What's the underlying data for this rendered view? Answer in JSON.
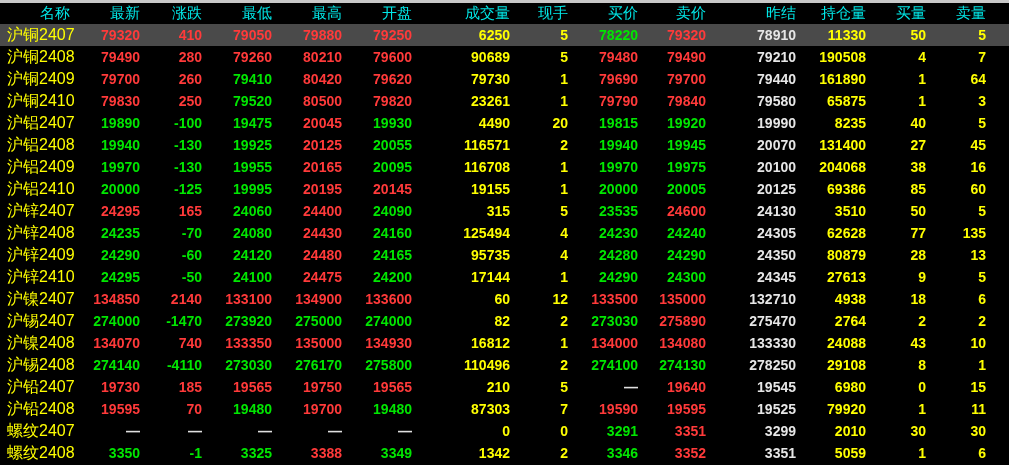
{
  "columns": [
    {
      "label": "名称",
      "kind": "name"
    },
    {
      "label": "最新",
      "kind": "price"
    },
    {
      "label": "涨跌",
      "kind": "price"
    },
    {
      "label": "最低",
      "kind": "price"
    },
    {
      "label": "最高",
      "kind": "price"
    },
    {
      "label": "开盘",
      "kind": "price"
    },
    {
      "label": "成交量",
      "kind": "volume"
    },
    {
      "label": "现手",
      "kind": "volume"
    },
    {
      "label": "买价",
      "kind": "price"
    },
    {
      "label": "卖价",
      "kind": "price"
    },
    {
      "label": "昨结",
      "kind": "reference"
    },
    {
      "label": "持仓量",
      "kind": "volume"
    },
    {
      "label": "买量",
      "kind": "volume"
    },
    {
      "label": "卖量",
      "kind": "volume"
    }
  ],
  "rows": [
    {
      "name": "沪铜2407",
      "selected": true,
      "cells": [
        {
          "text": "79320",
          "color": "#ff3a3a"
        },
        {
          "text": "410",
          "color": "#ff3a3a"
        },
        {
          "text": "79050",
          "color": "#ff3a3a"
        },
        {
          "text": "79880",
          "color": "#ff3a3a"
        },
        {
          "text": "79250",
          "color": "#ff3a3a"
        },
        {
          "text": "6250"
        },
        {
          "text": "5"
        },
        {
          "text": "78220",
          "color": "#00e600"
        },
        {
          "text": "79320",
          "color": "#ff3a3a"
        },
        {
          "text": "78910"
        },
        {
          "text": "11330"
        },
        {
          "text": "50"
        },
        {
          "text": "5"
        }
      ]
    },
    {
      "name": "沪铜2408",
      "selected": false,
      "cells": [
        {
          "text": "79490",
          "color": "#ff3a3a"
        },
        {
          "text": "280",
          "color": "#ff3a3a"
        },
        {
          "text": "79260",
          "color": "#ff3a3a"
        },
        {
          "text": "80210",
          "color": "#ff3a3a"
        },
        {
          "text": "79600",
          "color": "#ff3a3a"
        },
        {
          "text": "90689"
        },
        {
          "text": "5"
        },
        {
          "text": "79480",
          "color": "#ff3a3a"
        },
        {
          "text": "79490",
          "color": "#ff3a3a"
        },
        {
          "text": "79210"
        },
        {
          "text": "190508"
        },
        {
          "text": "4"
        },
        {
          "text": "7"
        }
      ]
    },
    {
      "name": "沪铜2409",
      "selected": false,
      "cells": [
        {
          "text": "79700",
          "color": "#ff3a3a"
        },
        {
          "text": "260",
          "color": "#ff3a3a"
        },
        {
          "text": "79410",
          "color": "#00e600"
        },
        {
          "text": "80420",
          "color": "#ff3a3a"
        },
        {
          "text": "79620",
          "color": "#ff3a3a"
        },
        {
          "text": "79730"
        },
        {
          "text": "1"
        },
        {
          "text": "79690",
          "color": "#ff3a3a"
        },
        {
          "text": "79700",
          "color": "#ff3a3a"
        },
        {
          "text": "79440"
        },
        {
          "text": "161890"
        },
        {
          "text": "1"
        },
        {
          "text": "64"
        }
      ]
    },
    {
      "name": "沪铜2410",
      "selected": false,
      "cells": [
        {
          "text": "79830",
          "color": "#ff3a3a"
        },
        {
          "text": "250",
          "color": "#ff3a3a"
        },
        {
          "text": "79520",
          "color": "#00e600"
        },
        {
          "text": "80500",
          "color": "#ff3a3a"
        },
        {
          "text": "79820",
          "color": "#ff3a3a"
        },
        {
          "text": "23261"
        },
        {
          "text": "1"
        },
        {
          "text": "79790",
          "color": "#ff3a3a"
        },
        {
          "text": "79840",
          "color": "#ff3a3a"
        },
        {
          "text": "79580"
        },
        {
          "text": "65875"
        },
        {
          "text": "1"
        },
        {
          "text": "3"
        }
      ]
    },
    {
      "name": "沪铝2407",
      "selected": false,
      "cells": [
        {
          "text": "19890",
          "color": "#00e600"
        },
        {
          "text": "-100",
          "color": "#00e600"
        },
        {
          "text": "19475",
          "color": "#00e600"
        },
        {
          "text": "20045",
          "color": "#ff3a3a"
        },
        {
          "text": "19930",
          "color": "#00e600"
        },
        {
          "text": "4490"
        },
        {
          "text": "20"
        },
        {
          "text": "19815",
          "color": "#00e600"
        },
        {
          "text": "19920",
          "color": "#00e600"
        },
        {
          "text": "19990"
        },
        {
          "text": "8235"
        },
        {
          "text": "40"
        },
        {
          "text": "5"
        }
      ]
    },
    {
      "name": "沪铝2408",
      "selected": false,
      "cells": [
        {
          "text": "19940",
          "color": "#00e600"
        },
        {
          "text": "-130",
          "color": "#00e600"
        },
        {
          "text": "19925",
          "color": "#00e600"
        },
        {
          "text": "20125",
          "color": "#ff3a3a"
        },
        {
          "text": "20055",
          "color": "#00e600"
        },
        {
          "text": "116571"
        },
        {
          "text": "2"
        },
        {
          "text": "19940",
          "color": "#00e600"
        },
        {
          "text": "19945",
          "color": "#00e600"
        },
        {
          "text": "20070"
        },
        {
          "text": "131400"
        },
        {
          "text": "27"
        },
        {
          "text": "45"
        }
      ]
    },
    {
      "name": "沪铝2409",
      "selected": false,
      "cells": [
        {
          "text": "19970",
          "color": "#00e600"
        },
        {
          "text": "-130",
          "color": "#00e600"
        },
        {
          "text": "19955",
          "color": "#00e600"
        },
        {
          "text": "20165",
          "color": "#ff3a3a"
        },
        {
          "text": "20095",
          "color": "#00e600"
        },
        {
          "text": "116708"
        },
        {
          "text": "1"
        },
        {
          "text": "19970",
          "color": "#00e600"
        },
        {
          "text": "19975",
          "color": "#00e600"
        },
        {
          "text": "20100"
        },
        {
          "text": "204068"
        },
        {
          "text": "38"
        },
        {
          "text": "16"
        }
      ]
    },
    {
      "name": "沪铝2410",
      "selected": false,
      "cells": [
        {
          "text": "20000",
          "color": "#00e600"
        },
        {
          "text": "-125",
          "color": "#00e600"
        },
        {
          "text": "19995",
          "color": "#00e600"
        },
        {
          "text": "20195",
          "color": "#ff3a3a"
        },
        {
          "text": "20145",
          "color": "#ff3a3a"
        },
        {
          "text": "19155"
        },
        {
          "text": "1"
        },
        {
          "text": "20000",
          "color": "#00e600"
        },
        {
          "text": "20005",
          "color": "#00e600"
        },
        {
          "text": "20125"
        },
        {
          "text": "69386"
        },
        {
          "text": "85"
        },
        {
          "text": "60"
        }
      ]
    },
    {
      "name": "沪锌2407",
      "selected": false,
      "cells": [
        {
          "text": "24295",
          "color": "#ff3a3a"
        },
        {
          "text": "165",
          "color": "#ff3a3a"
        },
        {
          "text": "24060",
          "color": "#00e600"
        },
        {
          "text": "24400",
          "color": "#ff3a3a"
        },
        {
          "text": "24090",
          "color": "#00e600"
        },
        {
          "text": "315"
        },
        {
          "text": "5"
        },
        {
          "text": "23535",
          "color": "#00e600"
        },
        {
          "text": "24600",
          "color": "#ff3a3a"
        },
        {
          "text": "24130"
        },
        {
          "text": "3510"
        },
        {
          "text": "50"
        },
        {
          "text": "5"
        }
      ]
    },
    {
      "name": "沪锌2408",
      "selected": false,
      "cells": [
        {
          "text": "24235",
          "color": "#00e600"
        },
        {
          "text": "-70",
          "color": "#00e600"
        },
        {
          "text": "24080",
          "color": "#00e600"
        },
        {
          "text": "24430",
          "color": "#ff3a3a"
        },
        {
          "text": "24160",
          "color": "#00e600"
        },
        {
          "text": "125494"
        },
        {
          "text": "4"
        },
        {
          "text": "24230",
          "color": "#00e600"
        },
        {
          "text": "24240",
          "color": "#00e600"
        },
        {
          "text": "24305"
        },
        {
          "text": "62628"
        },
        {
          "text": "77"
        },
        {
          "text": "135"
        }
      ]
    },
    {
      "name": "沪锌2409",
      "selected": false,
      "cells": [
        {
          "text": "24290",
          "color": "#00e600"
        },
        {
          "text": "-60",
          "color": "#00e600"
        },
        {
          "text": "24120",
          "color": "#00e600"
        },
        {
          "text": "24480",
          "color": "#ff3a3a"
        },
        {
          "text": "24165",
          "color": "#00e600"
        },
        {
          "text": "95735"
        },
        {
          "text": "4"
        },
        {
          "text": "24280",
          "color": "#00e600"
        },
        {
          "text": "24290",
          "color": "#00e600"
        },
        {
          "text": "24350"
        },
        {
          "text": "80879"
        },
        {
          "text": "28"
        },
        {
          "text": "13"
        }
      ]
    },
    {
      "name": "沪锌2410",
      "selected": false,
      "cells": [
        {
          "text": "24295",
          "color": "#00e600"
        },
        {
          "text": "-50",
          "color": "#00e600"
        },
        {
          "text": "24100",
          "color": "#00e600"
        },
        {
          "text": "24475",
          "color": "#ff3a3a"
        },
        {
          "text": "24200",
          "color": "#00e600"
        },
        {
          "text": "17144"
        },
        {
          "text": "1"
        },
        {
          "text": "24290",
          "color": "#00e600"
        },
        {
          "text": "24300",
          "color": "#00e600"
        },
        {
          "text": "24345"
        },
        {
          "text": "27613"
        },
        {
          "text": "9"
        },
        {
          "text": "5"
        }
      ]
    },
    {
      "name": "沪镍2407",
      "selected": false,
      "cells": [
        {
          "text": "134850",
          "color": "#ff3a3a"
        },
        {
          "text": "2140",
          "color": "#ff3a3a"
        },
        {
          "text": "133100",
          "color": "#ff3a3a"
        },
        {
          "text": "134900",
          "color": "#ff3a3a"
        },
        {
          "text": "133600",
          "color": "#ff3a3a"
        },
        {
          "text": "60"
        },
        {
          "text": "12"
        },
        {
          "text": "133500",
          "color": "#ff3a3a"
        },
        {
          "text": "135000",
          "color": "#ff3a3a"
        },
        {
          "text": "132710"
        },
        {
          "text": "4938"
        },
        {
          "text": "18"
        },
        {
          "text": "6"
        }
      ]
    },
    {
      "name": "沪锡2407",
      "selected": false,
      "cells": [
        {
          "text": "274000",
          "color": "#00e600"
        },
        {
          "text": "-1470",
          "color": "#00e600"
        },
        {
          "text": "273920",
          "color": "#00e600"
        },
        {
          "text": "275000",
          "color": "#00e600"
        },
        {
          "text": "274000",
          "color": "#00e600"
        },
        {
          "text": "82"
        },
        {
          "text": "2"
        },
        {
          "text": "273030",
          "color": "#00e600"
        },
        {
          "text": "275890",
          "color": "#ff3a3a"
        },
        {
          "text": "275470"
        },
        {
          "text": "2764"
        },
        {
          "text": "2"
        },
        {
          "text": "2"
        }
      ]
    },
    {
      "name": "沪镍2408",
      "selected": false,
      "cells": [
        {
          "text": "134070",
          "color": "#ff3a3a"
        },
        {
          "text": "740",
          "color": "#ff3a3a"
        },
        {
          "text": "133350",
          "color": "#ff3a3a"
        },
        {
          "text": "135000",
          "color": "#ff3a3a"
        },
        {
          "text": "134930",
          "color": "#ff3a3a"
        },
        {
          "text": "16812"
        },
        {
          "text": "1"
        },
        {
          "text": "134000",
          "color": "#ff3a3a"
        },
        {
          "text": "134080",
          "color": "#ff3a3a"
        },
        {
          "text": "133330"
        },
        {
          "text": "24088"
        },
        {
          "text": "43"
        },
        {
          "text": "10"
        }
      ]
    },
    {
      "name": "沪锡2408",
      "selected": false,
      "cells": [
        {
          "text": "274140",
          "color": "#00e600"
        },
        {
          "text": "-4110",
          "color": "#00e600"
        },
        {
          "text": "273030",
          "color": "#00e600"
        },
        {
          "text": "276170",
          "color": "#00e600"
        },
        {
          "text": "275800",
          "color": "#00e600"
        },
        {
          "text": "110496"
        },
        {
          "text": "2"
        },
        {
          "text": "274100",
          "color": "#00e600"
        },
        {
          "text": "274130",
          "color": "#00e600"
        },
        {
          "text": "278250"
        },
        {
          "text": "29108"
        },
        {
          "text": "8"
        },
        {
          "text": "1"
        }
      ]
    },
    {
      "name": "沪铅2407",
      "selected": false,
      "cells": [
        {
          "text": "19730",
          "color": "#ff3a3a"
        },
        {
          "text": "185",
          "color": "#ff3a3a"
        },
        {
          "text": "19565",
          "color": "#ff3a3a"
        },
        {
          "text": "19750",
          "color": "#ff3a3a"
        },
        {
          "text": "19565",
          "color": "#ff3a3a"
        },
        {
          "text": "210"
        },
        {
          "text": "5"
        },
        {
          "text": "—",
          "color": "#e0e0e0"
        },
        {
          "text": "19640",
          "color": "#ff3a3a"
        },
        {
          "text": "19545"
        },
        {
          "text": "6980"
        },
        {
          "text": "0"
        },
        {
          "text": "15"
        }
      ]
    },
    {
      "name": "沪铅2408",
      "selected": false,
      "cells": [
        {
          "text": "19595",
          "color": "#ff3a3a"
        },
        {
          "text": "70",
          "color": "#ff3a3a"
        },
        {
          "text": "19480",
          "color": "#00e600"
        },
        {
          "text": "19700",
          "color": "#ff3a3a"
        },
        {
          "text": "19480",
          "color": "#00e600"
        },
        {
          "text": "87303"
        },
        {
          "text": "7"
        },
        {
          "text": "19590",
          "color": "#ff3a3a"
        },
        {
          "text": "19595",
          "color": "#ff3a3a"
        },
        {
          "text": "19525"
        },
        {
          "text": "79920"
        },
        {
          "text": "1"
        },
        {
          "text": "11"
        }
      ]
    },
    {
      "name": "螺纹2407",
      "selected": false,
      "cells": [
        {
          "text": "—",
          "color": "#e0e0e0"
        },
        {
          "text": "—",
          "color": "#e0e0e0"
        },
        {
          "text": "—",
          "color": "#e0e0e0"
        },
        {
          "text": "—",
          "color": "#e0e0e0"
        },
        {
          "text": "—",
          "color": "#e0e0e0"
        },
        {
          "text": "0"
        },
        {
          "text": "0"
        },
        {
          "text": "3291",
          "color": "#00e600"
        },
        {
          "text": "3351",
          "color": "#ff3a3a"
        },
        {
          "text": "3299"
        },
        {
          "text": "2010"
        },
        {
          "text": "30"
        },
        {
          "text": "30"
        }
      ]
    },
    {
      "name": "螺纹2408",
      "selected": false,
      "cells": [
        {
          "text": "3350",
          "color": "#00e600"
        },
        {
          "text": "-1",
          "color": "#00e600"
        },
        {
          "text": "3325",
          "color": "#00e600"
        },
        {
          "text": "3388",
          "color": "#ff3a3a"
        },
        {
          "text": "3349",
          "color": "#00e600"
        },
        {
          "text": "1342"
        },
        {
          "text": "2"
        },
        {
          "text": "3346",
          "color": "#00e600"
        },
        {
          "text": "3352",
          "color": "#ff3a3a"
        },
        {
          "text": "3351"
        },
        {
          "text": "5059"
        },
        {
          "text": "1"
        },
        {
          "text": "6"
        }
      ]
    }
  ]
}
